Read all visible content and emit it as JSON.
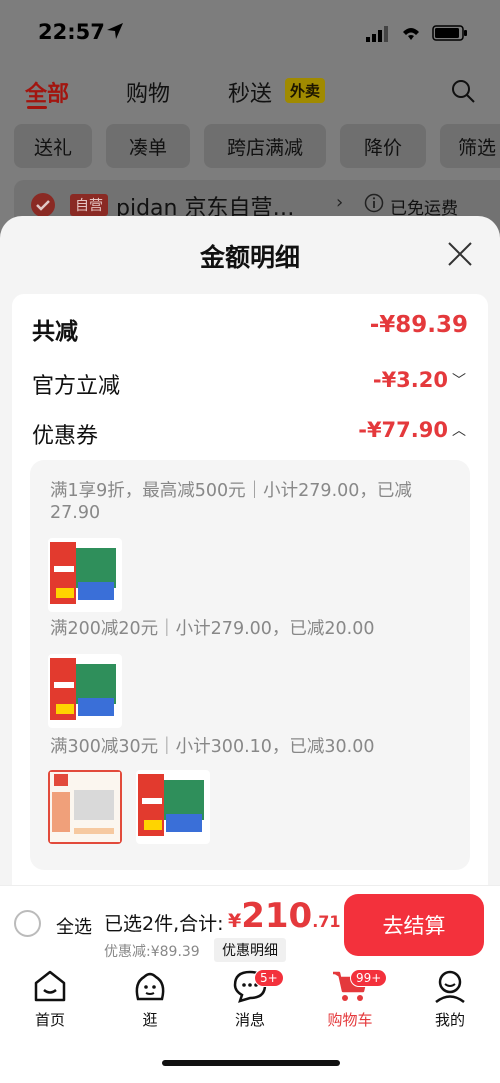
{
  "status": {
    "time": "22:57"
  },
  "top_tabs": [
    {
      "label": "全部",
      "active": true
    },
    {
      "label": "购物"
    },
    {
      "label": "秒送"
    }
  ],
  "waimai_badge": "外卖",
  "filters": [
    "送礼",
    "凑单",
    "跨店满减",
    "降价",
    "筛选"
  ],
  "store": {
    "tag": "自营",
    "name": "pidan 京东自营…",
    "shipping": "已免运费"
  },
  "sheet": {
    "title": "金额明细",
    "total_label": "共减",
    "total_amount": "-¥89.39",
    "official_label": "官方立减",
    "official_amount": "-¥3.20",
    "coupon_label": "优惠券",
    "coupon_amount": "-¥77.90",
    "coupons": [
      {
        "text": "满1享9折，最高减500元｜小计279.00，已减27.90"
      },
      {
        "text": "满200减20元｜小计279.00，已减20.00"
      },
      {
        "text": "满300减30元｜小计300.10，已减30.00"
      }
    ]
  },
  "checkout": {
    "select_all": "全选",
    "selected": "已选2件,合计:",
    "yen": "¥",
    "total_int": "210",
    "total_dec": ".71",
    "discount": "优惠减:¥89.39",
    "detail_btn": "优惠明细",
    "checkout_btn": "去结算"
  },
  "nav": [
    {
      "label": "首页",
      "icon": "home-icon"
    },
    {
      "label": "逛",
      "icon": "stroll-icon"
    },
    {
      "label": "消息",
      "icon": "message-icon",
      "badge": "5+"
    },
    {
      "label": "购物车",
      "icon": "cart-icon",
      "badge": "99+",
      "active": true
    },
    {
      "label": "我的",
      "icon": "profile-icon"
    }
  ],
  "colors": {
    "accent": "#e4393c",
    "button": "#f3313c"
  }
}
